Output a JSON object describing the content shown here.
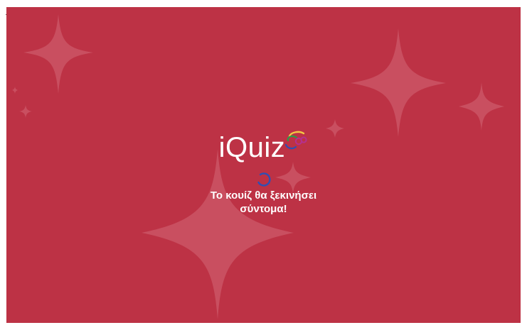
{
  "colors": {
    "background": "#bd3245",
    "sparkle": "#c94f60",
    "text": "#ffffff",
    "spinner_blue": "#2f4fb3"
  },
  "logo": {
    "text": "iQuiz",
    "icon": "iquiz-brain-icon"
  },
  "loading": {
    "spinner_icon": "loading-spinner-icon",
    "message": "Το κουίζ θα ξεκινήσει σύντομα!"
  }
}
